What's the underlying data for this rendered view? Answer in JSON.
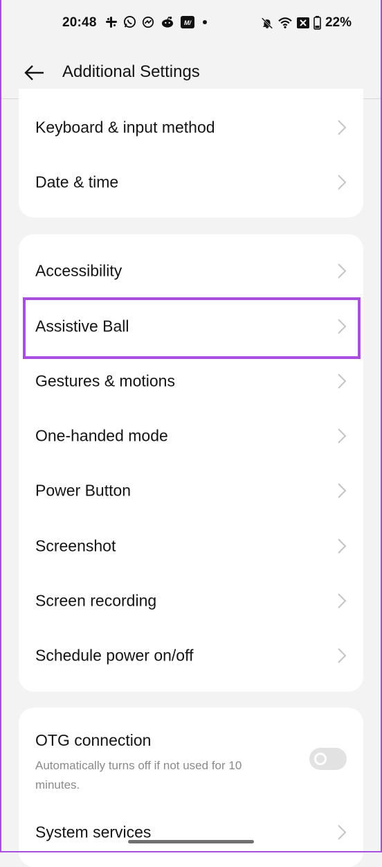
{
  "status_bar": {
    "time": "20:48",
    "battery": "22%",
    "left_icons": [
      "slack-icon",
      "whatsapp-icon",
      "messenger-icon",
      "reddit-icon",
      "mw-app-icon",
      "dot-icon"
    ],
    "right_icons": [
      "bell-muted-icon",
      "wifi-icon",
      "sim-disabled-icon",
      "battery-icon"
    ]
  },
  "header": {
    "title": "Additional Settings",
    "back_icon": "back-arrow-icon"
  },
  "groups": [
    {
      "items": [
        {
          "label": "Keyboard & input method"
        },
        {
          "label": "Date & time"
        }
      ]
    },
    {
      "items": [
        {
          "label": "Accessibility"
        },
        {
          "label": "Assistive Ball",
          "highlighted": true
        },
        {
          "label": "Gestures & motions"
        },
        {
          "label": "One-handed mode"
        },
        {
          "label": "Power Button"
        },
        {
          "label": "Screenshot"
        },
        {
          "label": "Screen recording"
        },
        {
          "label": "Schedule power on/off"
        }
      ]
    },
    {
      "otg": {
        "label": "OTG connection",
        "description": "Automatically turns off if not used for 10 minutes.",
        "enabled": false
      },
      "items": [
        {
          "label": "System services"
        }
      ]
    }
  ],
  "colors": {
    "background": "#f3f3f3",
    "card": "#ffffff",
    "highlight": "#a94fe0",
    "chevron": "#c4c4c4",
    "secondary_text": "#8a8a8a"
  }
}
